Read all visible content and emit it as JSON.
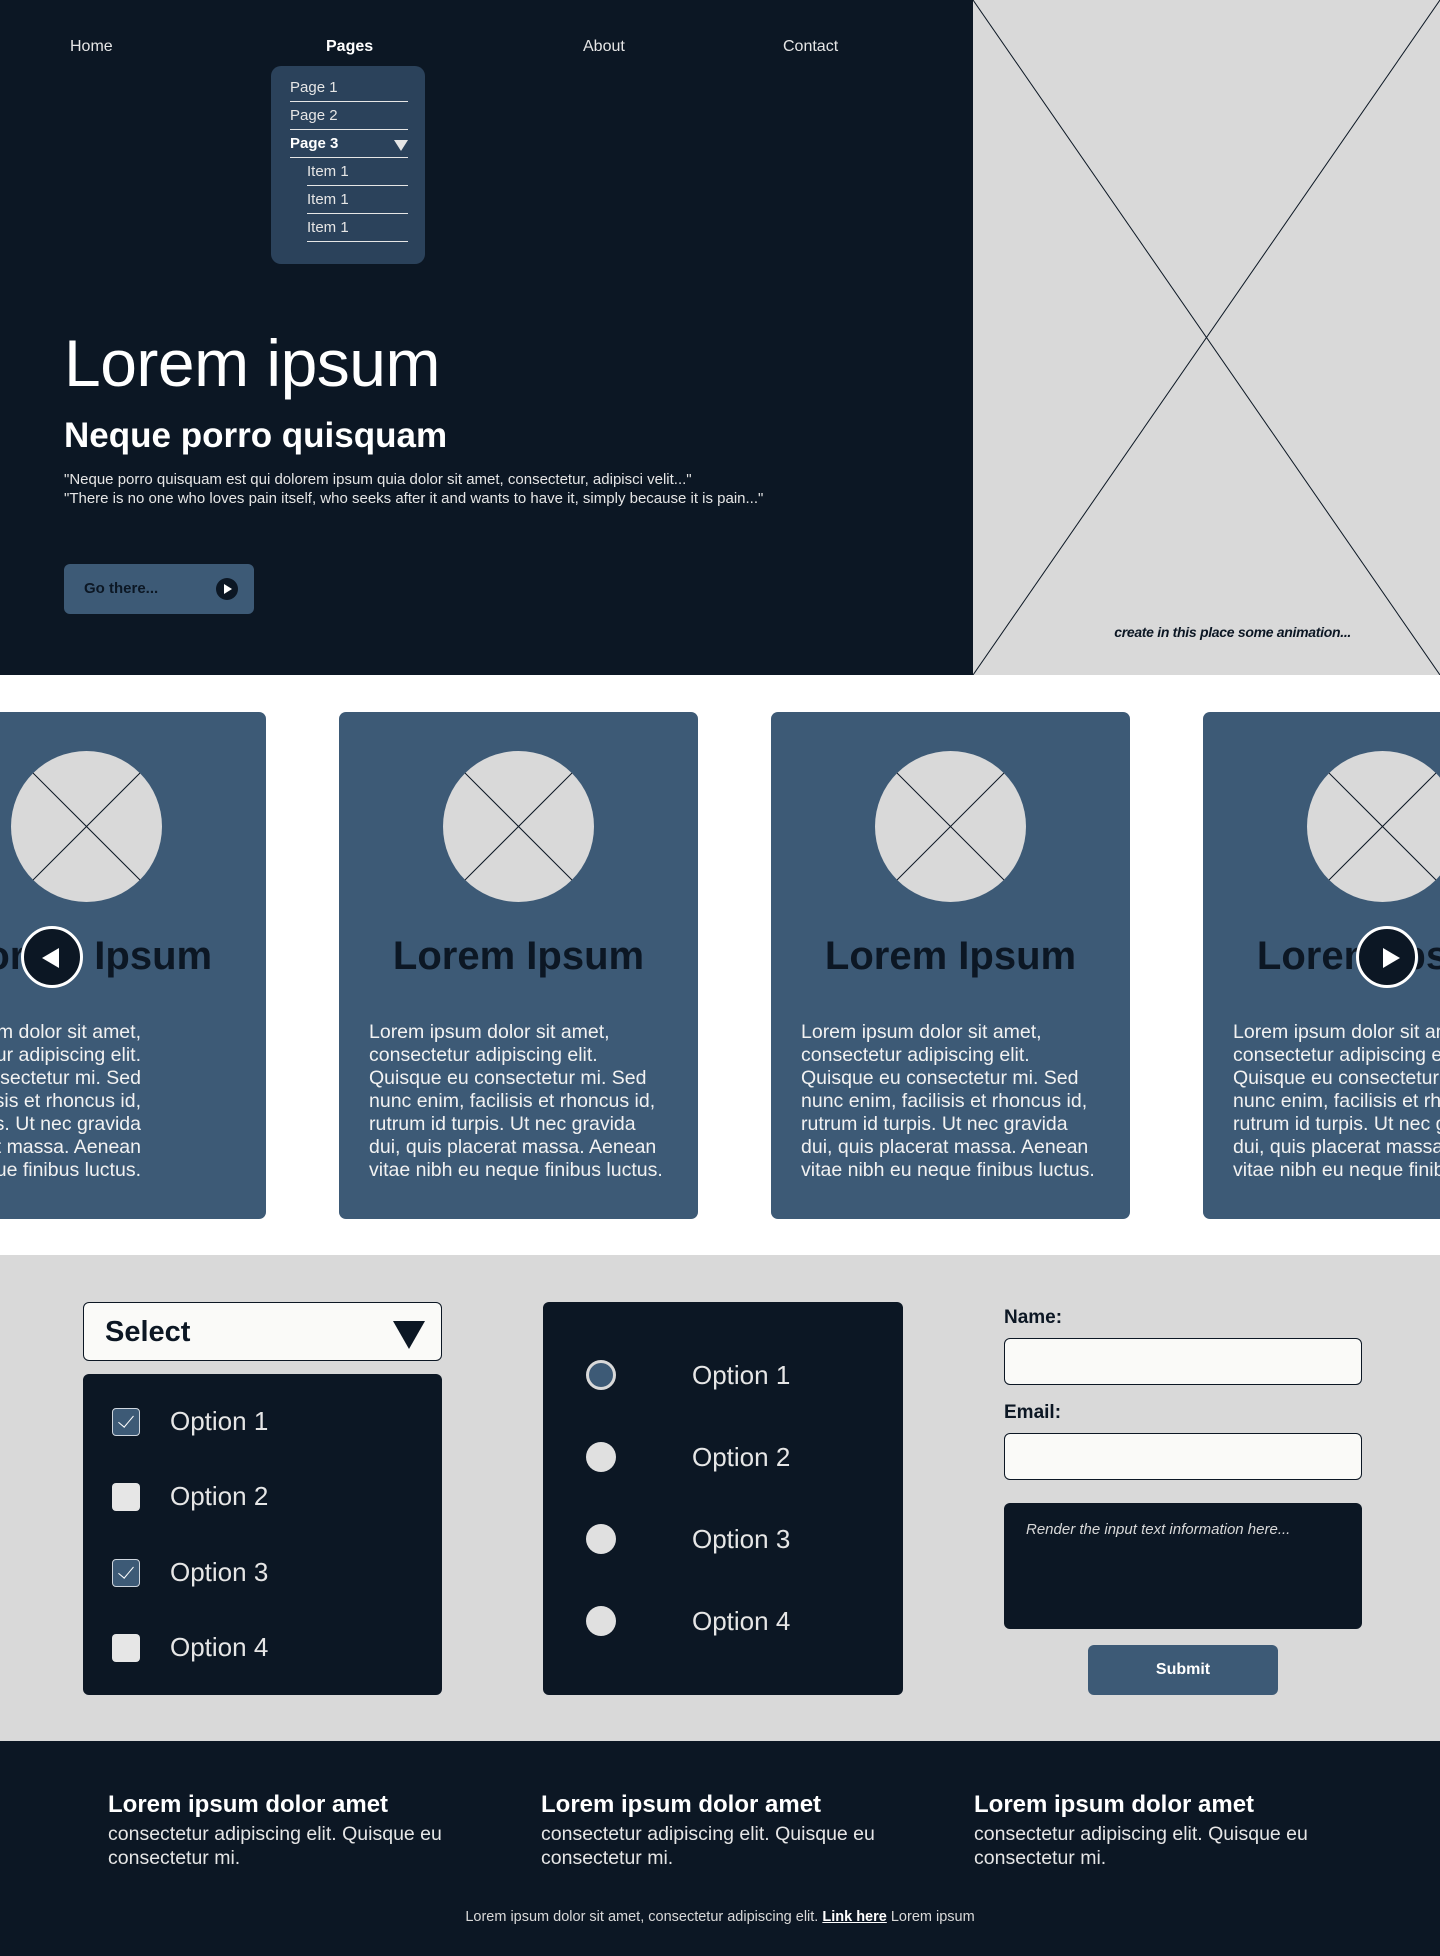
{
  "nav": {
    "items": [
      "Home",
      "Pages",
      "About",
      "Contact"
    ],
    "active": "Pages",
    "dropdown": {
      "pages": [
        "Page 1",
        "Page 2",
        "Page 3"
      ],
      "sub_items": [
        "Item 1",
        "Item 1",
        "Item 1"
      ]
    }
  },
  "hero": {
    "title": "Lorem ipsum",
    "subtitle": "Neque porro quisquam",
    "quote1": "\"Neque porro quisquam est qui dolorem ipsum quia dolor sit amet, consectetur, adipisci velit...\"",
    "quote2": "\"There is no one who loves pain itself, who seeks after it and wants to have it, simply because it is pain...\"",
    "cta_label": "Go there...",
    "animation_caption": "create in this place some animation..."
  },
  "cards": [
    {
      "title": "Lorem Ipsum",
      "lines": [
        "ipsum dolor sit amet,",
        "etur adipiscing elit.",
        "e eu consectetur mi. Sed",
        "nim, facilisis et rhoncus id,",
        "id turpis. Ut nec gravida",
        "s placerat massa. Aenean",
        "bh eu neque finibus luctus."
      ]
    },
    {
      "title": "Lorem Ipsum",
      "lines": [
        "Lorem ipsum dolor sit amet,",
        "consectetur adipiscing elit.",
        "Quisque eu consectetur mi. Sed",
        "nunc enim, facilisis et rhoncus id,",
        "rutrum id turpis. Ut nec gravida",
        "dui, quis placerat massa. Aenean",
        "vitae nibh eu neque finibus luctus."
      ]
    },
    {
      "title": "Lorem Ipsum",
      "lines": [
        "Lorem ipsum dolor sit amet,",
        "consectetur adipiscing elit.",
        "Quisque eu consectetur mi. Sed",
        "nunc enim, facilisis et rhoncus id,",
        "rutrum id turpis. Ut nec gravida",
        "dui, quis placerat massa. Aenean",
        "vitae nibh eu neque finibus luctus."
      ]
    },
    {
      "title": "Lorem Ipsum",
      "lines": [
        "Lorem ipsum dolor sit amet,",
        "consectetur adipiscing elit.",
        "Quisque eu consectetur mi. Sed",
        "nunc enim, facilisis et rhoncus id,",
        "rutrum id turpis. Ut nec gravida",
        "dui, quis placerat massa. Aenean",
        "vitae nibh eu neque finibus luctus."
      ]
    }
  ],
  "forms": {
    "select_label": "Select",
    "checkboxes": [
      {
        "label": "Option 1",
        "checked": true
      },
      {
        "label": "Option 2",
        "checked": false
      },
      {
        "label": "Option 3",
        "checked": true
      },
      {
        "label": "Option 4",
        "checked": false
      }
    ],
    "radios": [
      {
        "label": "Option 1",
        "selected": true
      },
      {
        "label": "Option 2",
        "selected": false
      },
      {
        "label": "Option 3",
        "selected": false
      },
      {
        "label": "Option 4",
        "selected": false
      }
    ],
    "name_label": "Name:",
    "email_label": "Email:",
    "textarea_placeholder": "Render the input text information here...",
    "submit_label": "Submit"
  },
  "footer": {
    "columns": [
      {
        "title": "Lorem ipsum dolor amet",
        "text": "consectetur adipiscing elit. Quisque eu consectetur mi."
      },
      {
        "title": "Lorem ipsum dolor amet",
        "text": "consectetur adipiscing elit. Quisque eu consectetur mi."
      },
      {
        "title": "Lorem ipsum dolor amet",
        "text": "consectetur adipiscing elit. Quisque eu consectetur mi."
      }
    ],
    "note_before": "Lorem ipsum dolor sit amet, consectetur adipiscing elit.",
    "link_text": "Link here",
    "note_after": "Lorem ipsum"
  },
  "colors": {
    "navy": "#0c1724",
    "slate": "#3d5a76",
    "dropdown_bg": "#2b425b",
    "placeholder_gray": "#d9d9d9"
  }
}
